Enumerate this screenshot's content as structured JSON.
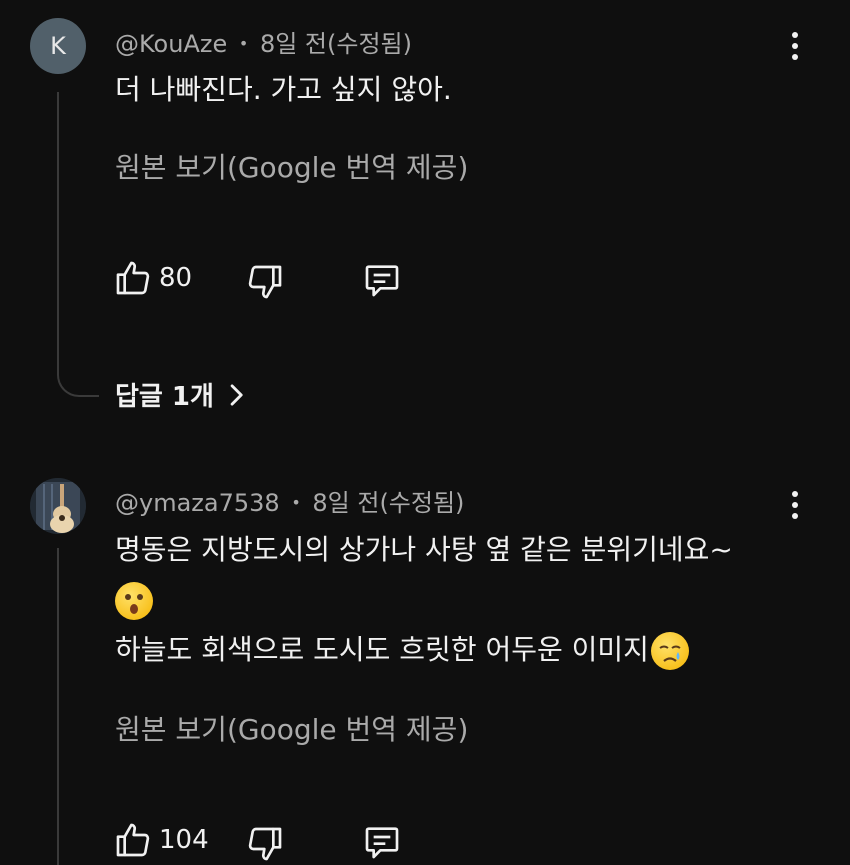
{
  "comments": [
    {
      "avatar_letter": "K",
      "author": "@KouAze",
      "separator": "•",
      "time": "8일 전(수정됨)",
      "text": "더 나빠진다. 가고 싶지 않아.",
      "translate": "원본 보기(Google 번역 제공)",
      "likes": "80",
      "replies": "답글 1개"
    },
    {
      "author": "@ymaza7538",
      "separator": "•",
      "time": "8일 전(수정됨)",
      "text_line1": "명동은 지방도시의 상가나 사탕 옆 같은 분위기네요~",
      "text_line3": "하늘도 회색으로 도시도 흐릿한 어두운 이미지",
      "translate": "원본 보기(Google 번역 제공)",
      "likes": "104"
    }
  ],
  "icons": {
    "like": "thumbs-up-icon",
    "dislike": "thumbs-down-icon",
    "reply": "comment-icon",
    "more": "more-vertical-icon",
    "chevron": "chevron-right-icon"
  },
  "colors": {
    "background": "#0f0f0f",
    "text": "#f1f1f1",
    "secondary": "#aaaaaa"
  }
}
